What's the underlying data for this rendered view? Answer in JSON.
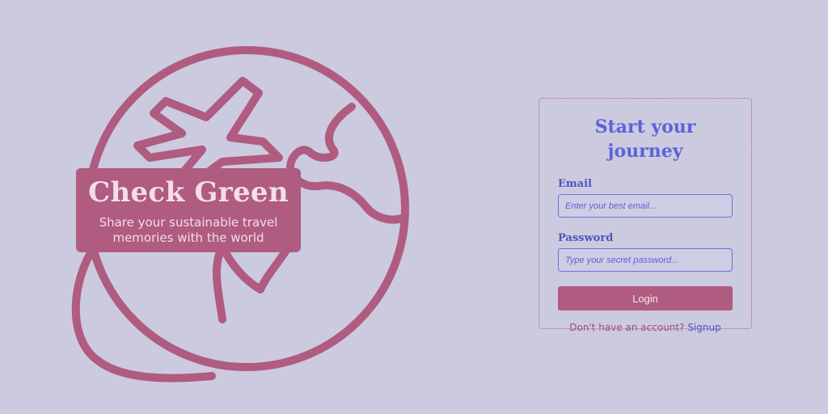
{
  "brand": {
    "title": "Check Green",
    "tagline_line1": "Share your sustainable travel",
    "tagline_line2": "memories with the world",
    "illustration": "globe-airplane-icon"
  },
  "login": {
    "title": "Start your journey",
    "email_label": "Email",
    "email_placeholder": "Enter your best email...",
    "password_label": "Password",
    "password_placeholder": "Type your secret password...",
    "button_label": "Login",
    "signup_prompt": "Don't have an account?",
    "signup_link": "Signup"
  },
  "colors": {
    "background": "#cccadf",
    "brand_pink": "#b05b80",
    "accent_blue": "#5a63d9"
  }
}
